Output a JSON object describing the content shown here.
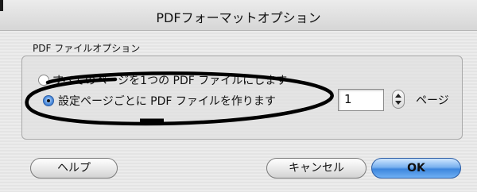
{
  "window": {
    "title": "PDFフォーマットオプション"
  },
  "group": {
    "label": "PDF ファイルオプション",
    "options": [
      {
        "label": "すべてのページを1つの PDF ファイルにします",
        "selected": false
      },
      {
        "label": "設定ページごとに PDF ファイルを作ります",
        "selected": true
      }
    ],
    "pages_value": "1",
    "pages_unit": "ページ"
  },
  "buttons": {
    "help": "ヘルプ",
    "cancel": "キャンセル",
    "ok": "OK"
  },
  "colors": {
    "accent": "#3d86dd",
    "annotation": "#000000"
  },
  "icons": {
    "stepper": "stepper-arrows-icon",
    "radio": "radio-button-icon"
  }
}
